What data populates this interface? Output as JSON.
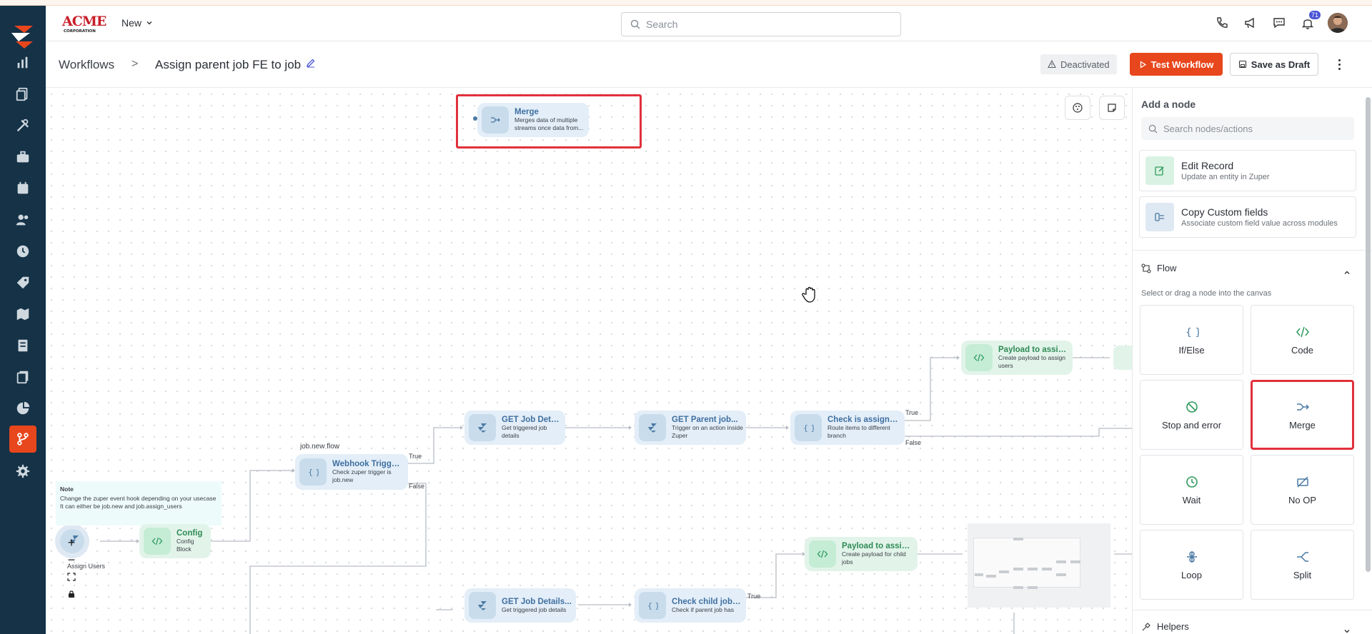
{
  "header": {
    "brand_top": "ACME",
    "brand_bottom": "CORPORATION",
    "new_label": "New",
    "search_placeholder": "Search",
    "notification_count": "71"
  },
  "breadcrumb": {
    "root": "Workflows",
    "separator": ">",
    "current": "Assign parent job FE to job"
  },
  "actions": {
    "status": "Deactivated",
    "test": "Test Workflow",
    "draft": "Save as Draft"
  },
  "canvas": {
    "note": {
      "title": "Note",
      "line1": "Change the zuper event hook depending on your usecase",
      "line2": "It can either be job.new and job.assign_users"
    },
    "flow_label": "job.new flow",
    "assign_label": "Assign Users",
    "nodes": {
      "merge": {
        "title": "Merge",
        "sub": "Merges data of multiple streams once data from..."
      },
      "config": {
        "title": "Config",
        "sub": "Config Block"
      },
      "webhook": {
        "title": "Webhook Trigger...",
        "sub": "Check zuper trigger is job.new"
      },
      "get_job": {
        "title": "GET Job Details",
        "sub": "Get triggered job details"
      },
      "get_parent": {
        "title": "GET Parent job...",
        "sub": "Trigger on an action inside Zuper"
      },
      "check_assigned": {
        "title": "Check is assigned...",
        "sub": "Route items to different branch"
      },
      "payload_assign": {
        "title": "Payload to assign...",
        "sub": "Create payload to assign users"
      },
      "payload_child": {
        "title": "Payload to assign...",
        "sub": "Create payload for child jobs"
      },
      "get_job2": {
        "title": "GET Job Details...",
        "sub": "Get triggered job details"
      },
      "check_child": {
        "title": "Check child jobs...",
        "sub": "Check if parent job has"
      }
    },
    "edges": {
      "webhook_true": "True",
      "webhook_false": "False",
      "check_true": "True",
      "check_false": "False",
      "child_true": "True"
    }
  },
  "panel": {
    "title": "Add a node",
    "search_placeholder": "Search nodes/actions",
    "actions": [
      {
        "title": "Edit Record",
        "sub": "Update an entity in Zuper"
      },
      {
        "title": "Copy Custom fields",
        "sub": "Associate custom field value across modules"
      }
    ],
    "flow_section": "Flow",
    "flow_hint": "Select or drag a node into the canvas",
    "tiles": [
      "If/Else",
      "Code",
      "Stop and error",
      "Merge",
      "Wait",
      "No OP",
      "Loop",
      "Split"
    ],
    "helpers_section": "Helpers"
  },
  "colors": {
    "accent": "#e8461c",
    "rail": "#153247",
    "highlight": "#e0313b"
  }
}
